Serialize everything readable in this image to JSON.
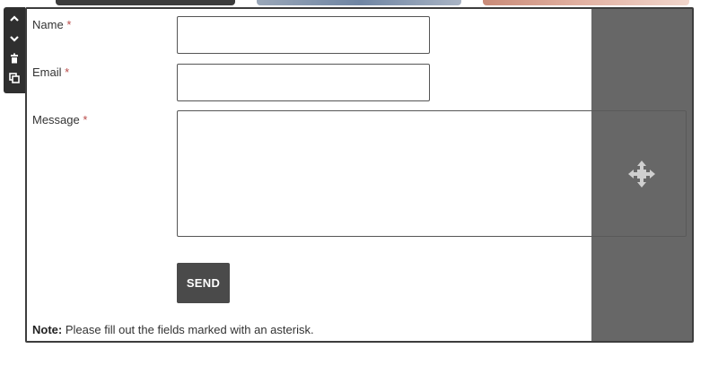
{
  "toolbar": {
    "move_up_icon": "chevron-up-icon",
    "move_down_icon": "chevron-down-icon",
    "delete_icon": "trash-icon",
    "duplicate_icon": "copy-icon"
  },
  "form": {
    "name_label": "Name",
    "email_label": "Email",
    "message_label": "Message",
    "required_marker": "*",
    "name_value": "",
    "email_value": "",
    "message_value": "",
    "send_label": "SEND",
    "note_bold": "Note:",
    "note_text": "Please fill out the fields marked with an asterisk."
  },
  "overlay": {
    "handle_icon": "move-icon"
  },
  "colors": {
    "required": "#b94a48",
    "button": "#4a4a4a",
    "overlay": "#5a5a5a"
  }
}
